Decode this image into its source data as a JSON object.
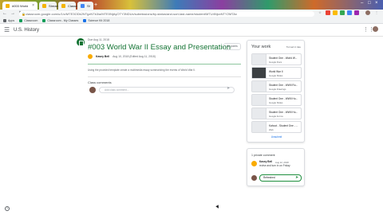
{
  "browser": {
    "tabs": [
      {
        "title": "#003 World War II Essay"
      },
      {
        "title": "Stream"
      },
      {
        "title": "Classroom"
      },
      {
        "title": "Shadow Box Histo"
      }
    ],
    "url": "classroom.google.com/u/1/c/MTE3ODk2NTgzNTk3/a/MTE0NjAyOTY3NDUx/submissions/by-status/and-sort-last-name/student/MTU4NjcxNTY2MTAx",
    "bookmarks": [
      "Apps",
      "Classroom",
      "Classroom - My Classes",
      "Science Kit 2018"
    ]
  },
  "header": {
    "class_name": "U.S. History"
  },
  "assignment": {
    "due": "Due Aug 11, 2018",
    "title": "#003 World War II Essay and Presentation",
    "author": "Kasey Bell",
    "meta": "Aug 10, 2018 (Edited Aug 11, 2018)",
    "points_label": "All points",
    "instructions": "Using the provided template create a multimedia essay summarizing the events of World War II.",
    "class_comments_label": "Class comments",
    "class_comment_placeholder": "Add class comment..."
  },
  "your_work": {
    "title": "Your work",
    "status": "Turned in late",
    "attachments": [
      {
        "name": "Student One - World W...",
        "type": "Google Docs"
      },
      {
        "name": "World War II",
        "type": "Google Slides"
      },
      {
        "name": "Student One - WWII Ro...",
        "type": "Google Drawings"
      },
      {
        "name": "Student One - WWII Ho...",
        "type": "Google Slides"
      },
      {
        "name": "Student One - WWII Ho...",
        "type": "Google Forms"
      },
      {
        "name": "Kahoot - Student One - ...",
        "type": "Web"
      }
    ],
    "unsubmit_label": "Unsubmit"
  },
  "private_comments": {
    "title": "1 private comment",
    "author": "Kasey Bell",
    "date": "Aug 12, 2018",
    "text": "revise and turn in on Friday",
    "input_value": "Refreshed"
  }
}
